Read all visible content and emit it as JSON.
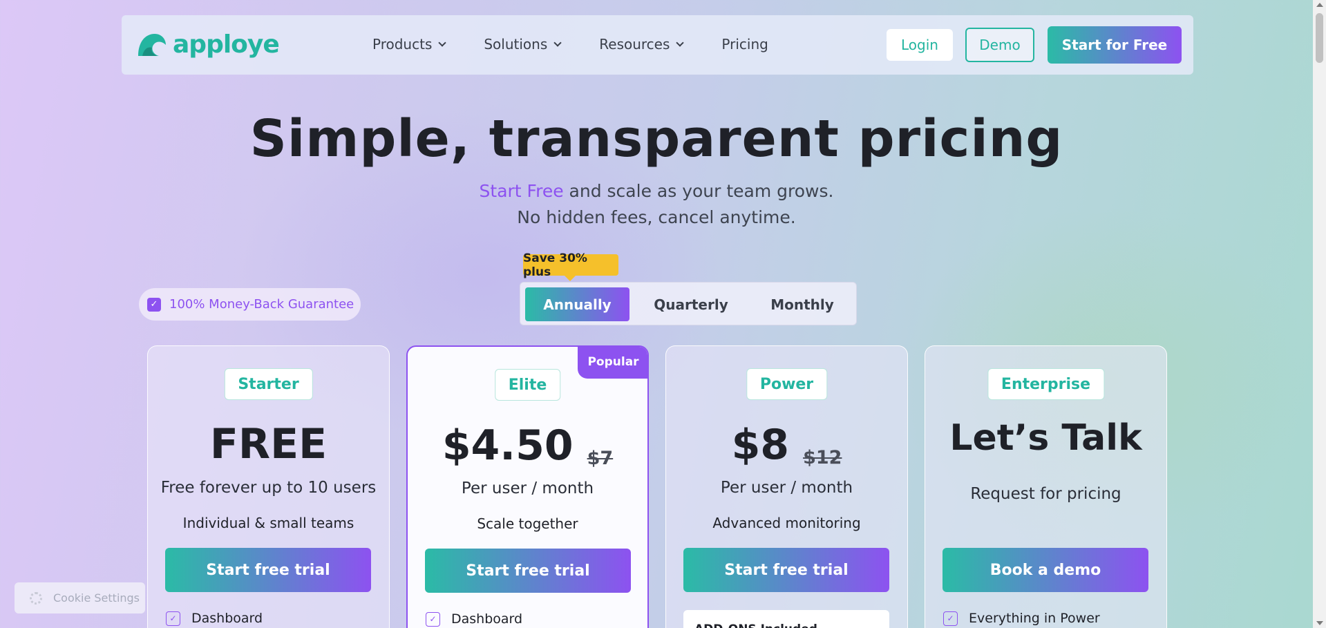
{
  "brand": {
    "name": "apploye",
    "accent": "#23b5a0",
    "purple": "#8d52f0",
    "logo_icon": "wave-logo-icon"
  },
  "nav": {
    "items": [
      {
        "label": "Products",
        "has_dropdown": true
      },
      {
        "label": "Solutions",
        "has_dropdown": true
      },
      {
        "label": "Resources",
        "has_dropdown": true
      },
      {
        "label": "Pricing",
        "has_dropdown": false
      }
    ],
    "login_label": "Login",
    "demo_label": "Demo",
    "start_label": "Start for Free"
  },
  "hero": {
    "title": "Simple, transparent pricing",
    "sub_accent": "Start Free",
    "sub_rest": " and scale as your team grows.",
    "sub2": "No hidden fees, cancel anytime."
  },
  "guarantee": {
    "label": "100% Money-Back Guarantee",
    "icon": "check-icon"
  },
  "billing": {
    "save_tag": "Save 30% plus",
    "options": [
      "Annually",
      "Quarterly",
      "Monthly"
    ],
    "selected": "Annually"
  },
  "plans": [
    {
      "name": "Starter",
      "price": "FREE",
      "line1": "Free forever up to 10 users",
      "line2": "Individual & small teams",
      "cta": "Start free trial",
      "feature": "Dashboard"
    },
    {
      "name": "Elite",
      "price": "$4.50",
      "old_price": "$7",
      "line1": "Per user / month",
      "line2": "Scale together",
      "cta": "Start free trial",
      "feature": "Dashboard",
      "badge": "Popular"
    },
    {
      "name": "Power",
      "price": "$8",
      "old_price": "$12",
      "line1": "Per user / month",
      "line2": "Advanced monitoring",
      "cta": "Start free trial",
      "addon": "ADD-ONS Included"
    },
    {
      "name": "Enterprise",
      "price": "Let’s Talk",
      "line1": "Request for pricing",
      "cta": "Book a demo",
      "feature": "Everything in Power"
    }
  ],
  "cookie": {
    "label": "Cookie Settings",
    "icon": "gear-icon"
  }
}
